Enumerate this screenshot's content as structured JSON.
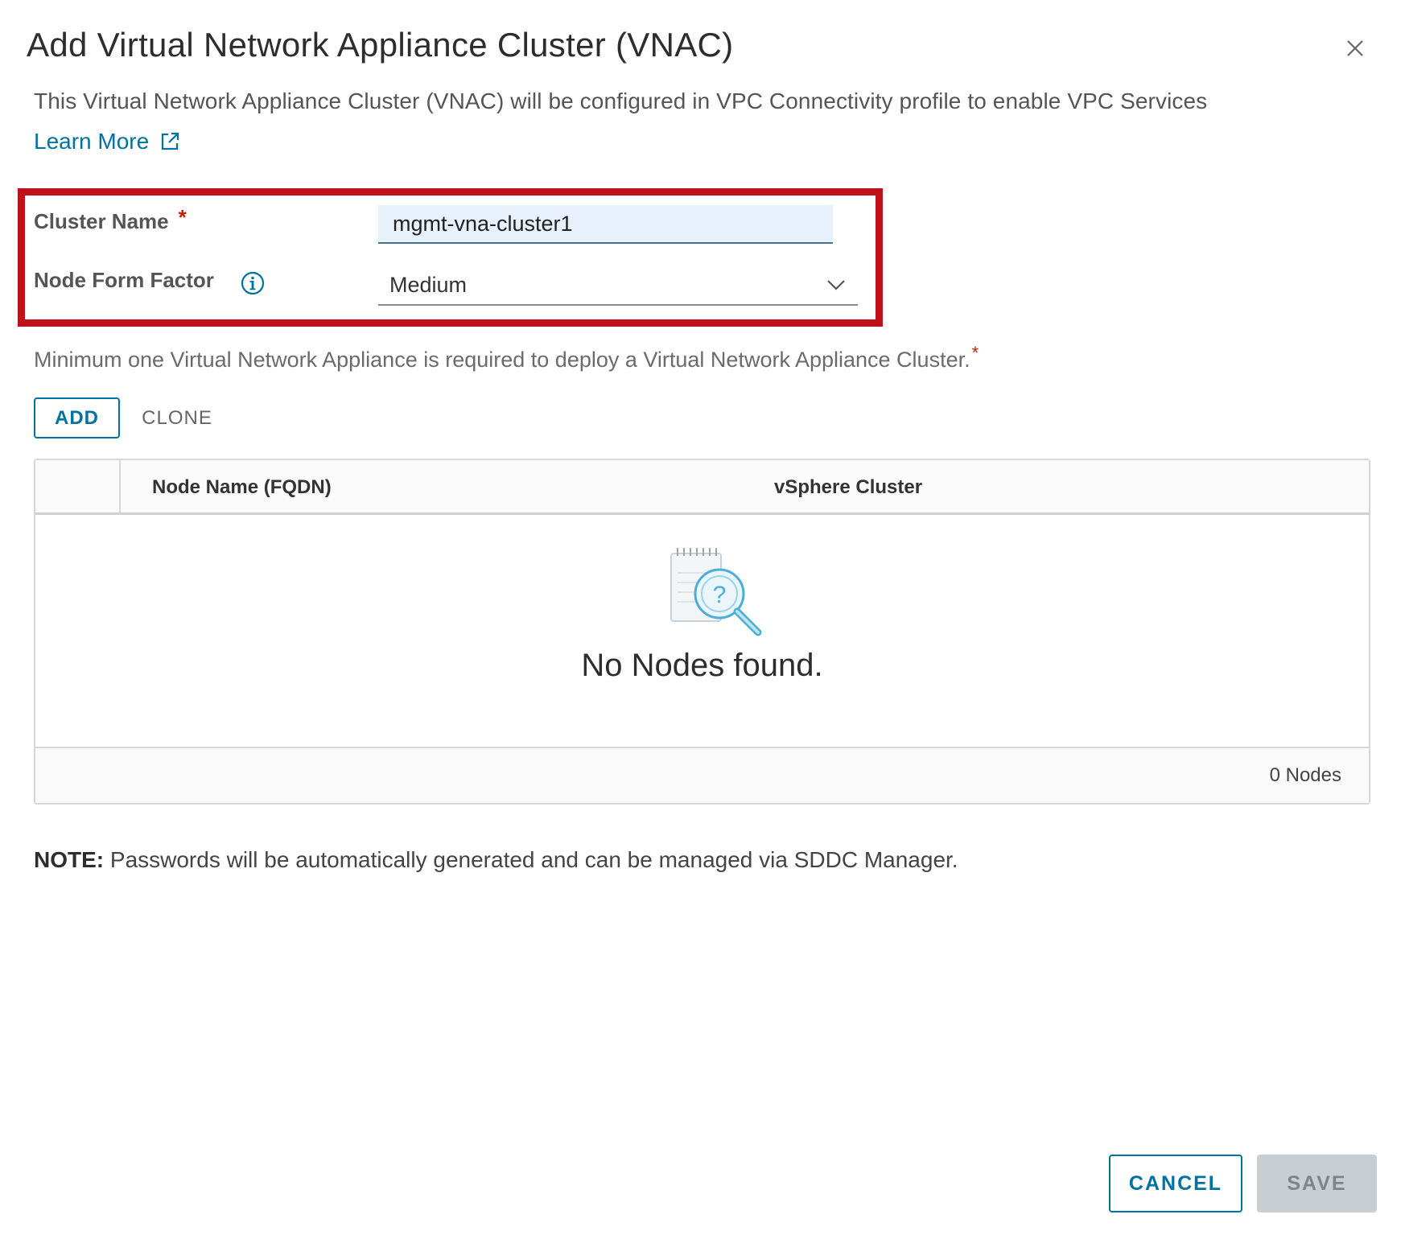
{
  "dialog": {
    "title": "Add Virtual Network Appliance Cluster (VNAC)",
    "close_icon": "close-icon",
    "description": "This Virtual Network Appliance Cluster (VNAC) will be configured in VPC Connectivity profile to enable VPC Services",
    "learn_more": "Learn More",
    "learn_more_icon": "external-link-icon"
  },
  "form": {
    "cluster_name_label": "Cluster Name",
    "required_marker": "*",
    "cluster_name_value": "mgmt-vna-cluster1",
    "node_form_factor_label": "Node Form Factor",
    "info_icon": "info-icon",
    "node_form_factor_value": "Medium",
    "highlight_color": "#c0101a"
  },
  "nodes": {
    "requirement_text": "Minimum one Virtual Network Appliance is required to deploy a Virtual Network Appliance Cluster.",
    "add_label": "ADD",
    "clone_label": "CLONE",
    "columns": [
      "Node Name (FQDN)",
      "vSphere Cluster"
    ],
    "rows": [],
    "empty_icon": "search-document-icon",
    "empty_message": "No Nodes found.",
    "footer_count": "0 Nodes"
  },
  "note": {
    "label": "NOTE:",
    "text": " Passwords will be automatically generated and can be managed via SDDC Manager."
  },
  "footer": {
    "cancel_label": "CANCEL",
    "save_label": "SAVE"
  },
  "colors": {
    "accent": "#0072a3",
    "required": "#c21d00",
    "disabled_button": "#c9ced2"
  }
}
